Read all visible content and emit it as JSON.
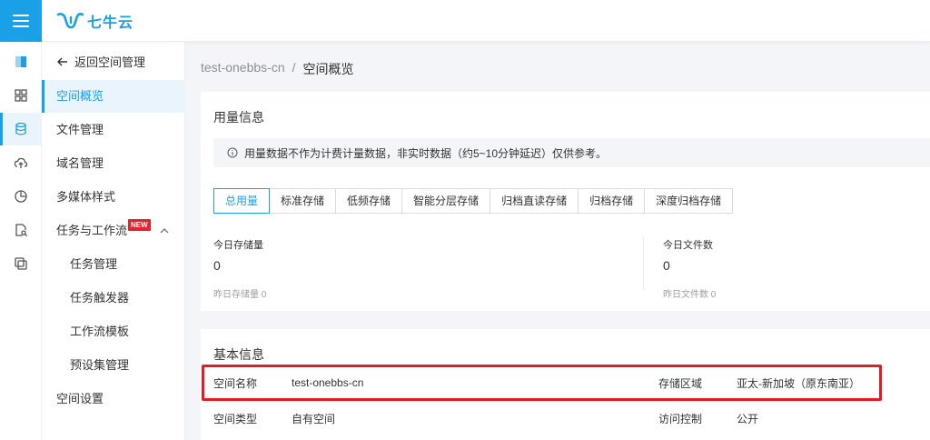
{
  "header": {
    "logo_text": "七牛云"
  },
  "rail": {
    "items": [
      "storage-cube",
      "grid",
      "database",
      "cloud-upload",
      "pie-chart",
      "file-search",
      "copy"
    ]
  },
  "sidebar": {
    "back_label": "返回空间管理",
    "items": [
      {
        "label": "空间概览",
        "active": true
      },
      {
        "label": "文件管理"
      },
      {
        "label": "域名管理"
      },
      {
        "label": "多媒体样式"
      },
      {
        "label": "任务与工作流",
        "badge": "NEW"
      },
      {
        "label": "任务管理",
        "sub": true
      },
      {
        "label": "任务触发器",
        "sub": true
      },
      {
        "label": "工作流模板",
        "sub": true
      },
      {
        "label": "预设集管理",
        "sub": true
      },
      {
        "label": "空间设置"
      }
    ]
  },
  "breadcrumb": {
    "bucket": "test-onebbs-cn",
    "separator": "/",
    "current": "空间概览"
  },
  "usage": {
    "title": "用量信息",
    "notice": "用量数据不作为计费计量数据，非实时数据（约5~10分钟延迟）仅供参考。",
    "tabs": [
      "总用量",
      "标准存储",
      "低频存储",
      "智能分层存储",
      "归档直读存储",
      "归档存储",
      "深度归档存储"
    ],
    "active_tab": 0,
    "storage": {
      "label": "今日存储量",
      "value": "0",
      "prev": "昨日存储量 0"
    },
    "files": {
      "label": "今日文件数",
      "value": "0",
      "prev": "昨日文件数 0"
    }
  },
  "basic": {
    "title": "基本信息",
    "rows": [
      {
        "k1": "空间名称",
        "v1": "test-onebbs-cn",
        "k2": "存储区域",
        "v2": "亚太-新加坡（原东南亚）"
      },
      {
        "k1": "空间类型",
        "v1": "自有空间",
        "k2": "访问控制",
        "v2": "公开"
      }
    ]
  },
  "colors": {
    "accent": "#1aa0e6",
    "highlight": "#e31b23",
    "badge": "#e5222a"
  }
}
